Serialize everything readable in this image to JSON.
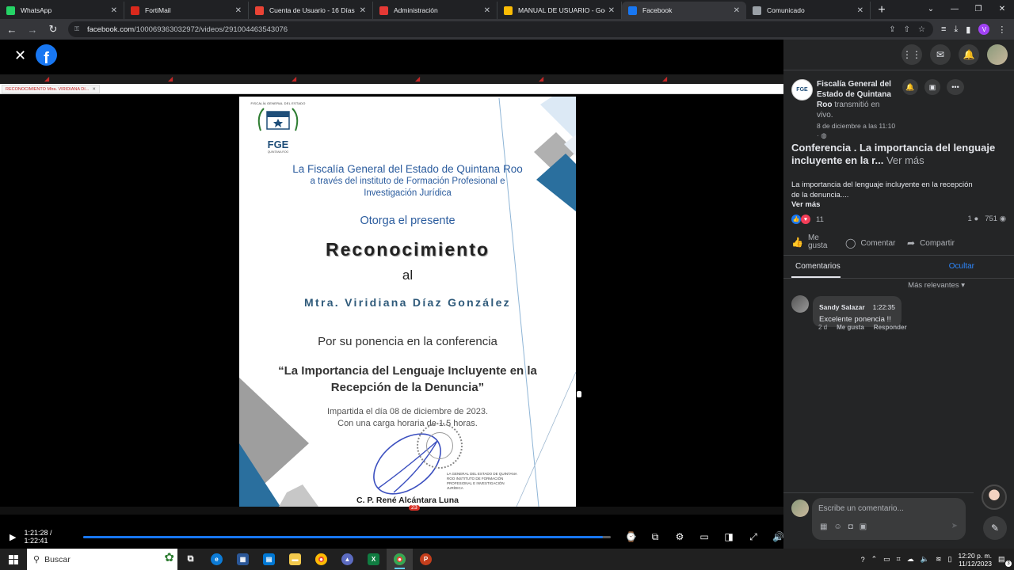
{
  "browser": {
    "tabs": [
      {
        "label": "WhatsApp",
        "icon": "whatsapp-icon",
        "color": "#25d366"
      },
      {
        "label": "FortiMail",
        "icon": "fortimail-icon",
        "color": "#da291c"
      },
      {
        "label": "Cuenta de Usuario - 16 Días de",
        "icon": "gmail-icon",
        "color": "#ea4335"
      },
      {
        "label": "Administración",
        "icon": "admin-icon",
        "color": "#e53935"
      },
      {
        "label": "MANUAL DE USUARIO - Google",
        "icon": "google-drive-icon",
        "color": "#fbbc04"
      },
      {
        "label": "Facebook",
        "icon": "facebook-icon",
        "color": "#1877f2",
        "active": true
      },
      {
        "label": "Comunicado",
        "icon": "globe-icon",
        "color": "#9aa0a6"
      }
    ],
    "url_host": "facebook.com",
    "url_path": "/100069363032972/videos/291004463543076"
  },
  "video": {
    "doc_tab": "RECONOCIMIENTO Mtra. VIRIDIANA Dí...",
    "chat_badge": "23",
    "time_current": "1:21:28",
    "time_total": "1:22:41",
    "progress_fraction": 0.9851
  },
  "certificate": {
    "logo_top": "FISCALÍA GENERAL DEL ESTADO",
    "logo_abbr": "FGE",
    "logo_bottom": "QUINTANA ROO",
    "line1": "La Fiscalía General del Estado de Quintana Roo",
    "line2": "a través del instituto de Formación Profesional e",
    "line3": "Investigación Jurídica",
    "grants": "Otorga el presente",
    "recognition": "Reconocimiento",
    "to": "al",
    "recipient": "Mtra. Viridiana Díaz González",
    "reason": "Por su ponencia en la conferencia",
    "conf_title_1": "“La Importancia del Lenguaje Incluyente en la",
    "conf_title_2": "Recepción de la Denuncia”",
    "date_line": "Impartida el día 08 de diciembre de 2023.",
    "hours_line": "Con una carga horaria de 1.5 horas.",
    "stamp_text": "LA GENERAL DEL ESTADO DE QUINTANA ROO INSTITUTO DE FORMACIÓN PROFESIONAL E INVESTIGACIÓN JURÍDICA",
    "signer": "C. P. René Alcántara Luna"
  },
  "post": {
    "page_name": "Fiscalía General del Estado de Quintana Roo",
    "live_text": "transmitió en vivo.",
    "date": "8 de diciembre a las 11:10",
    "title": "Conferencia . La importancia del lenguaje incluyente en la r...",
    "title_more": "Ver más",
    "description": "La importancia del lenguaje incluyente en la recepción de la denuncia....",
    "more": "Ver más",
    "reactions_count": "11",
    "comments_count": "1",
    "views_count": "751",
    "like_label": "Me gusta",
    "comment_label": "Comentar",
    "share_label": "Compartir",
    "comments_tab": "Comentarios",
    "hide_label": "Ocultar",
    "sort_label": "Más relevantes"
  },
  "comment": {
    "author": "Sandy Salazar",
    "time": "1:22:35",
    "text": "Excelente ponencia !!",
    "age": "2 d",
    "like": "Me gusta",
    "reply": "Responder"
  },
  "composer": {
    "placeholder": "Escribe un comentario..."
  },
  "taskbar": {
    "search_label": "Buscar",
    "time": "12:20 p. m.",
    "date": "11/12/2023",
    "notif_count": "3"
  }
}
